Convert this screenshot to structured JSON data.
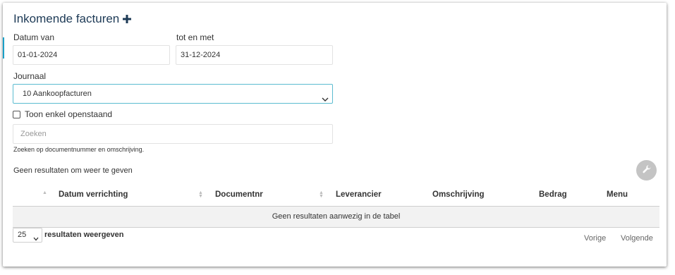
{
  "header": {
    "title": "Inkomende facturen"
  },
  "filters": {
    "date_from_label": "Datum van",
    "date_from_value": "01-01-2024",
    "date_to_label": "tot en met",
    "date_to_value": "31-12-2024",
    "journal_label": "Journaal",
    "journal_value": "10 Aankoopfacturen",
    "open_only_label": "Toon enkel openstaand",
    "search_placeholder": "Zoeken",
    "search_hint": "Zoeken op documentnummer en omschrijving."
  },
  "results": {
    "summary": "Geen resultaten om weer te geven",
    "columns": [
      "Datum verrichting",
      "Documentnr",
      "Leverancier",
      "Omschrijving",
      "Bedrag",
      "Menu"
    ],
    "empty_message": "Geen resultaten aanwezig in de tabel",
    "page_length": "25",
    "page_length_label": "resultaten weergeven",
    "prev_label": "Vorige",
    "next_label": "Volgende"
  },
  "colors": {
    "accent": "#1aa0c8",
    "title": "#1d3a56",
    "select_border": "#5bbcd0"
  },
  "icons": {
    "add": "plus-icon",
    "settings": "wrench-icon",
    "dropdown": "chevron-down-icon"
  }
}
